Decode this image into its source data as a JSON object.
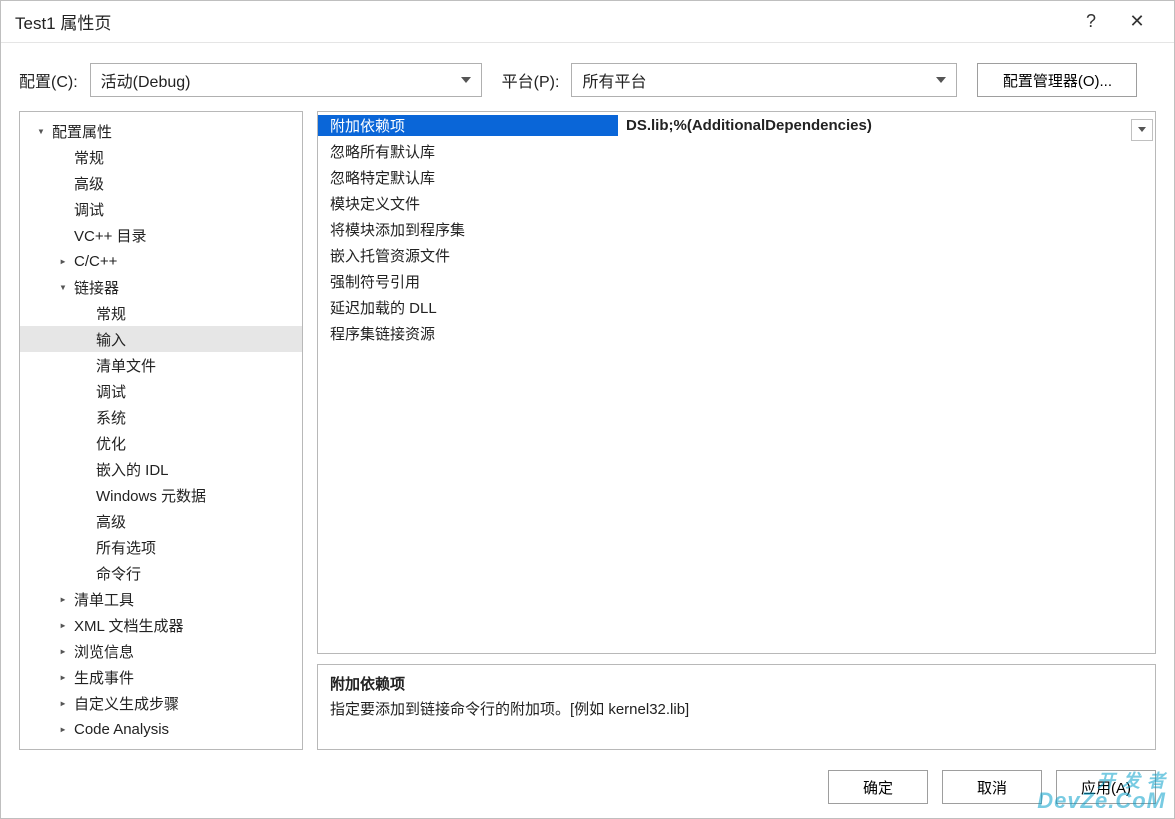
{
  "window": {
    "title": "Test1 属性页",
    "help_icon": "?",
    "close_icon": "✕"
  },
  "configRow": {
    "configLabel": "配置(C):",
    "configValue": "活动(Debug)",
    "platformLabel": "平台(P):",
    "platformValue": "所有平台",
    "configManagerBtn": "配置管理器(O)..."
  },
  "tree": [
    {
      "label": "配置属性",
      "indent": 0,
      "expander": "▾",
      "selected": false
    },
    {
      "label": "常规",
      "indent": 1,
      "expander": "",
      "selected": false
    },
    {
      "label": "高级",
      "indent": 1,
      "expander": "",
      "selected": false
    },
    {
      "label": "调试",
      "indent": 1,
      "expander": "",
      "selected": false
    },
    {
      "label": "VC++ 目录",
      "indent": 1,
      "expander": "",
      "selected": false
    },
    {
      "label": "C/C++",
      "indent": 1,
      "expander": "▸",
      "selected": false
    },
    {
      "label": "链接器",
      "indent": 1,
      "expander": "▾",
      "selected": false
    },
    {
      "label": "常规",
      "indent": 2,
      "expander": "",
      "selected": false
    },
    {
      "label": "输入",
      "indent": 2,
      "expander": "",
      "selected": true
    },
    {
      "label": "清单文件",
      "indent": 2,
      "expander": "",
      "selected": false
    },
    {
      "label": "调试",
      "indent": 2,
      "expander": "",
      "selected": false
    },
    {
      "label": "系统",
      "indent": 2,
      "expander": "",
      "selected": false
    },
    {
      "label": "优化",
      "indent": 2,
      "expander": "",
      "selected": false
    },
    {
      "label": "嵌入的 IDL",
      "indent": 2,
      "expander": "",
      "selected": false
    },
    {
      "label": "Windows 元数据",
      "indent": 2,
      "expander": "",
      "selected": false
    },
    {
      "label": "高级",
      "indent": 2,
      "expander": "",
      "selected": false
    },
    {
      "label": "所有选项",
      "indent": 2,
      "expander": "",
      "selected": false
    },
    {
      "label": "命令行",
      "indent": 2,
      "expander": "",
      "selected": false
    },
    {
      "label": "清单工具",
      "indent": 1,
      "expander": "▸",
      "selected": false
    },
    {
      "label": "XML 文档生成器",
      "indent": 1,
      "expander": "▸",
      "selected": false
    },
    {
      "label": "浏览信息",
      "indent": 1,
      "expander": "▸",
      "selected": false
    },
    {
      "label": "生成事件",
      "indent": 1,
      "expander": "▸",
      "selected": false
    },
    {
      "label": "自定义生成步骤",
      "indent": 1,
      "expander": "▸",
      "selected": false
    },
    {
      "label": "Code Analysis",
      "indent": 1,
      "expander": "▸",
      "selected": false
    }
  ],
  "grid": [
    {
      "label": "附加依赖项",
      "value": "DS.lib;%(AdditionalDependencies)",
      "selected": true,
      "dropdown": true
    },
    {
      "label": "忽略所有默认库",
      "value": "",
      "selected": false
    },
    {
      "label": "忽略特定默认库",
      "value": "",
      "selected": false
    },
    {
      "label": "模块定义文件",
      "value": "",
      "selected": false
    },
    {
      "label": "将模块添加到程序集",
      "value": "",
      "selected": false
    },
    {
      "label": "嵌入托管资源文件",
      "value": "",
      "selected": false
    },
    {
      "label": "强制符号引用",
      "value": "",
      "selected": false
    },
    {
      "label": "延迟加载的 DLL",
      "value": "",
      "selected": false
    },
    {
      "label": "程序集链接资源",
      "value": "",
      "selected": false
    }
  ],
  "description": {
    "title": "附加依赖项",
    "body": "指定要添加到链接命令行的附加项。[例如 kernel32.lib]"
  },
  "footer": {
    "ok": "确定",
    "cancel": "取消",
    "apply": "应用(A)"
  },
  "watermark": {
    "line1": "开 发 者",
    "line2": "DevZe.CoM"
  }
}
